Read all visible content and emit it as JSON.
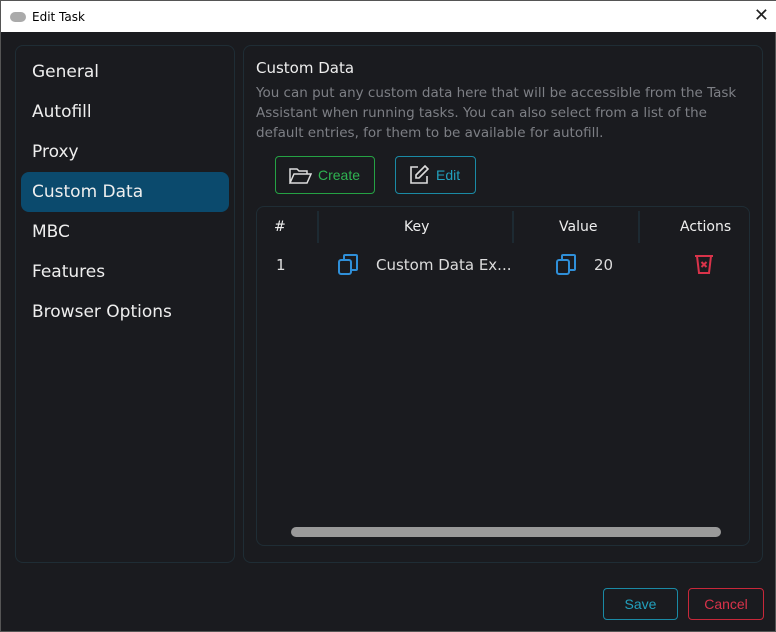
{
  "window": {
    "title": "Edit Task",
    "close": "✕"
  },
  "sidebar": {
    "items": [
      {
        "label": "General"
      },
      {
        "label": "Autofill"
      },
      {
        "label": "Proxy"
      },
      {
        "label": "Custom Data"
      },
      {
        "label": "MBC"
      },
      {
        "label": "Features"
      },
      {
        "label": "Browser Options"
      }
    ],
    "active": "Custom Data"
  },
  "main": {
    "title": "Custom Data",
    "description": "You can put any custom data here that will be accessible from the Task Assistant when running tasks. You can also select from a list of the default entries, for them to be available for autofill.",
    "create_label": "Create",
    "edit_label": "Edit",
    "columns": [
      "#",
      "Key",
      "Value",
      "Actions"
    ],
    "rows": [
      {
        "index": "1",
        "key": "Custom Data Ex...",
        "value": "20"
      }
    ]
  },
  "footer": {
    "save": "Save",
    "cancel": "Cancel"
  },
  "colors": {
    "accent": "#0b4a6d",
    "create": "#2fb351",
    "edit": "#22a0bd",
    "danger": "#d9334a",
    "copy": "#2f8fd8"
  }
}
